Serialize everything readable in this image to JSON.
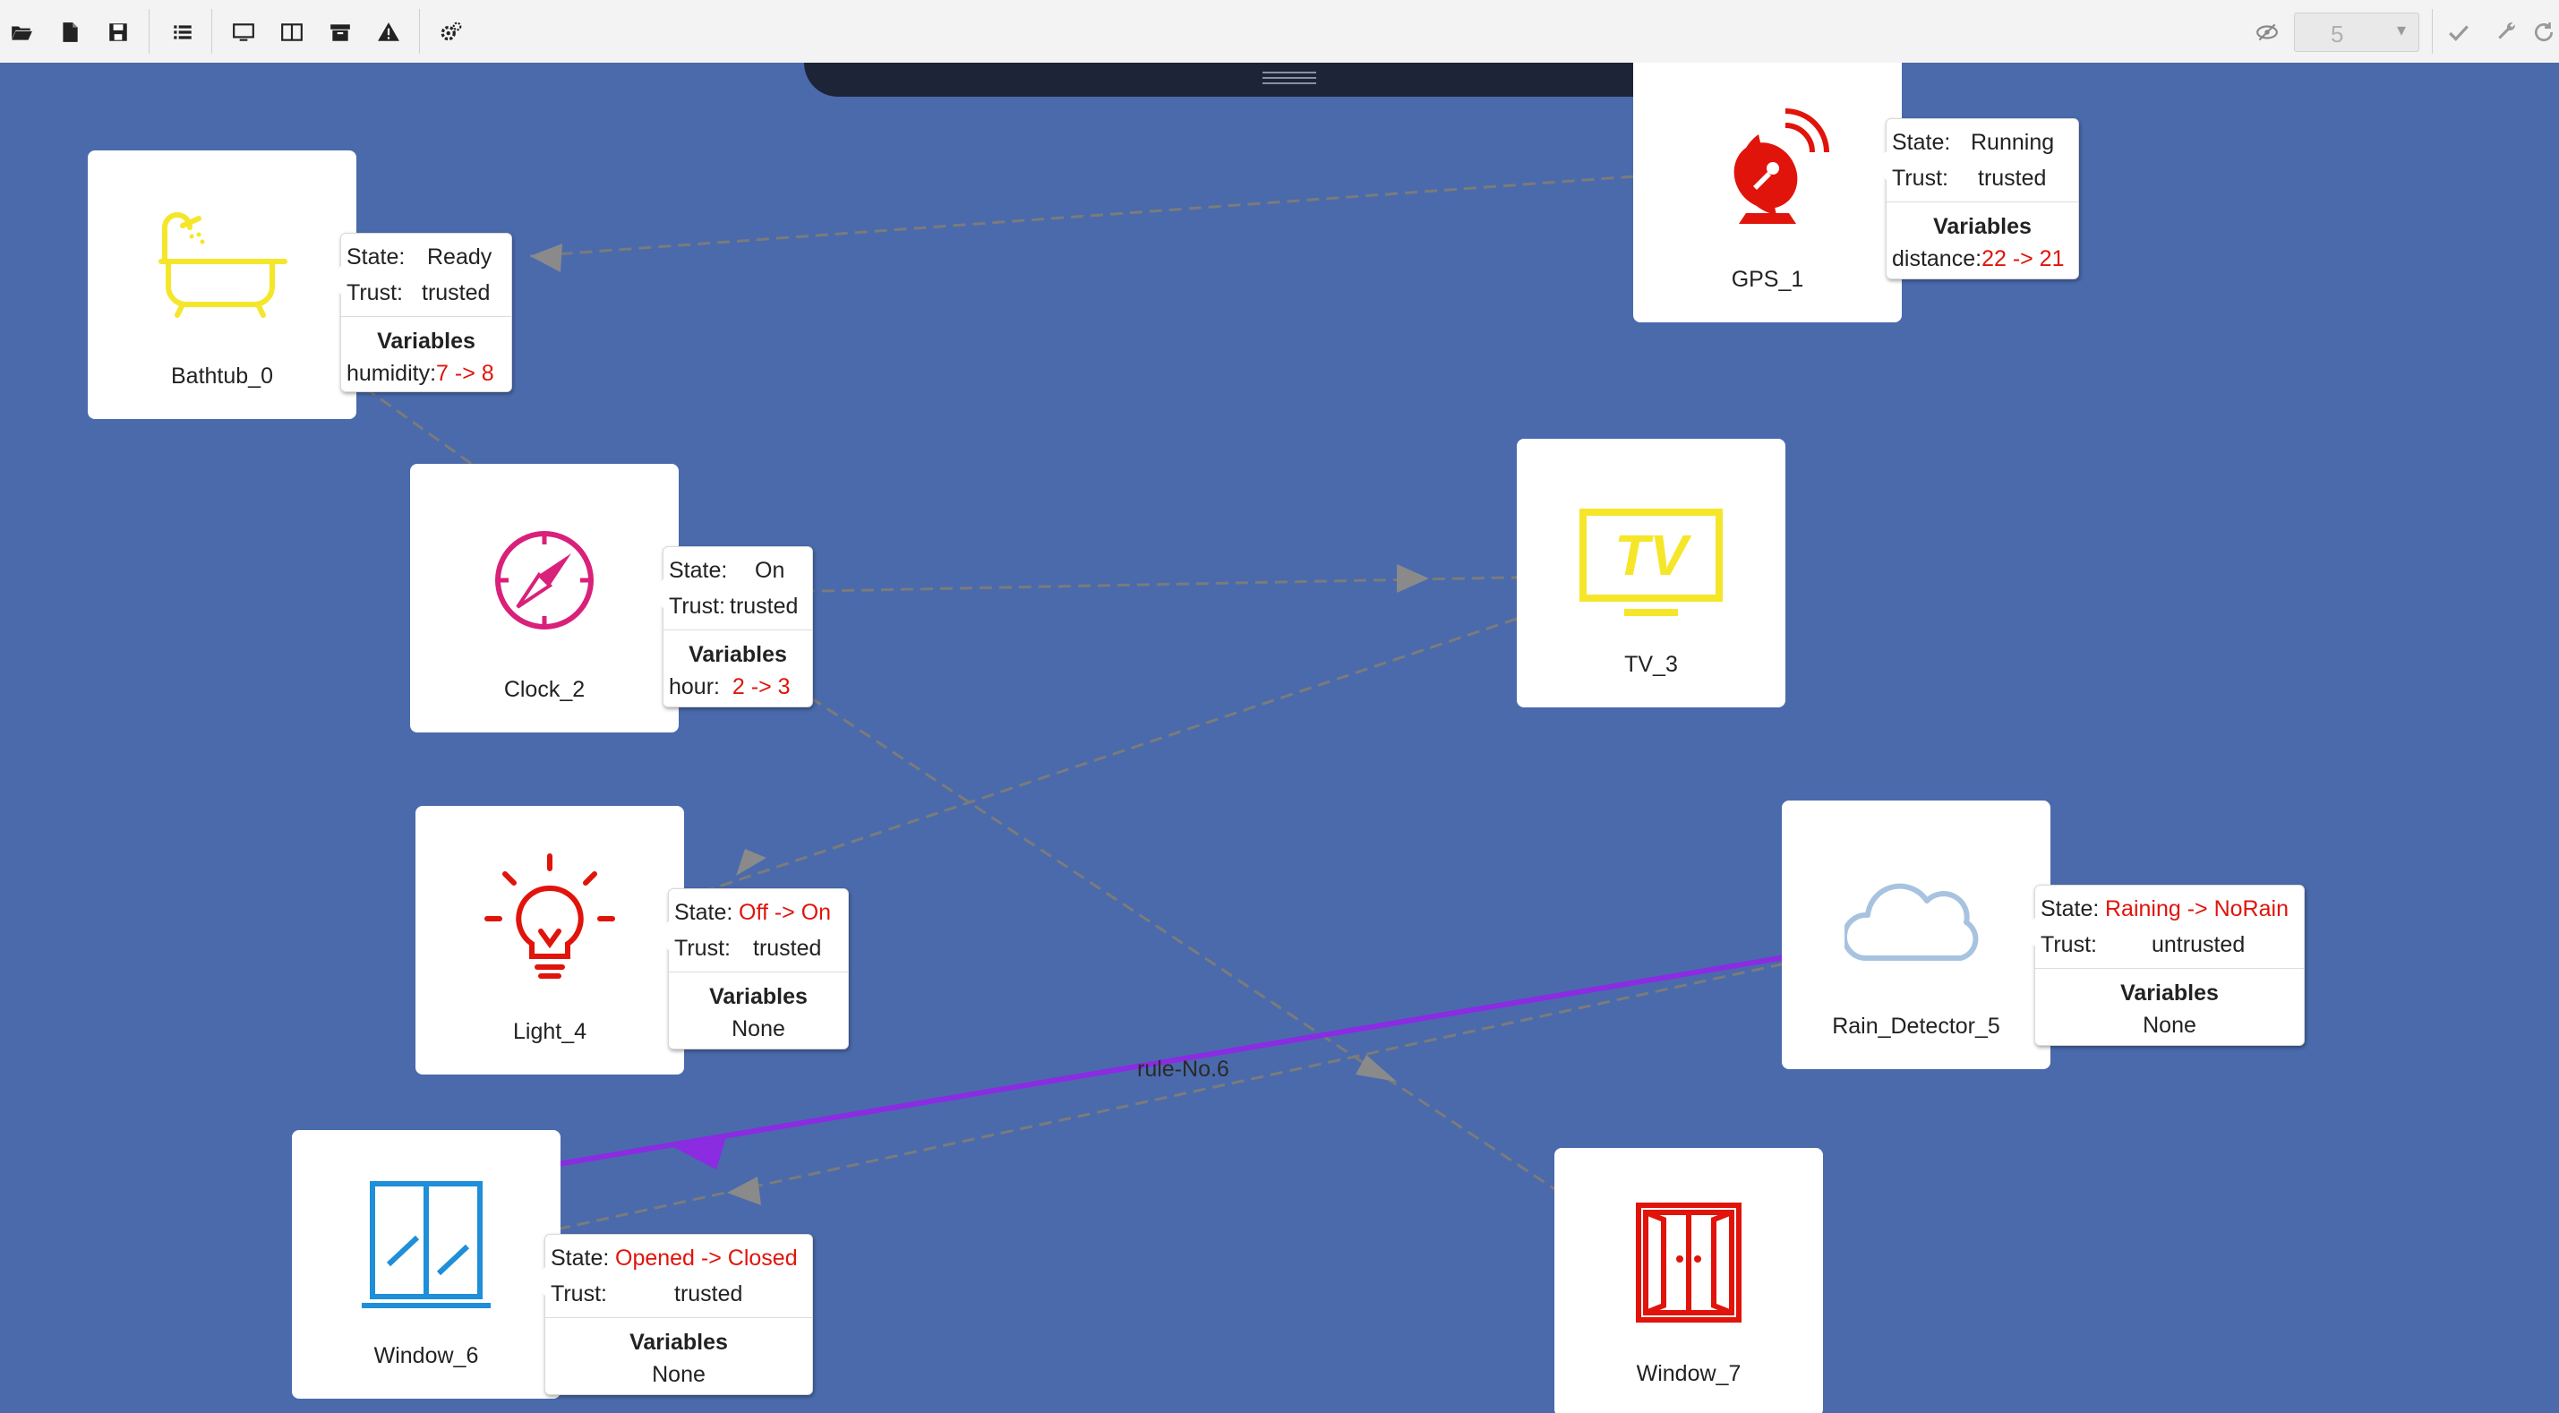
{
  "toolbar": {
    "left_icons": [
      "open-folder-icon",
      "new-file-icon",
      "save-icon",
      "list-icon",
      "monitor-icon",
      "columns-icon",
      "archive-icon",
      "warning-icon",
      "settings-icon"
    ],
    "right_icons": [
      "eye-off-icon",
      "check-icon",
      "wrench-icon",
      "refresh-icon"
    ],
    "step_value": "5"
  },
  "devices": [
    {
      "id": "bathtub",
      "name": "Bathtub_0",
      "icon": "bathtub-icon",
      "state": "Ready",
      "trust": "trusted",
      "variables_label": "Variables",
      "variable_name": "humidity:",
      "variable_value": "7 -> 8"
    },
    {
      "id": "gps",
      "name": "GPS_1",
      "icon": "satellite-dish-icon",
      "state": "Running",
      "trust": "trusted",
      "variables_label": "Variables",
      "variable_name": "distance:",
      "variable_value": "22 -> 21"
    },
    {
      "id": "clock",
      "name": "Clock_2",
      "icon": "compass-icon",
      "state": "On",
      "trust": "trusted",
      "variables_label": "Variables",
      "variable_name": "hour:",
      "variable_value": "2 -> 3"
    },
    {
      "id": "tv",
      "name": "TV_3",
      "icon": "tv-icon"
    },
    {
      "id": "light",
      "name": "Light_4",
      "icon": "lightbulb-icon",
      "state": "Off -> On",
      "trust": "trusted",
      "variables_label": "Variables",
      "variables_none": "None"
    },
    {
      "id": "rain",
      "name": "Rain_Detector_5",
      "icon": "cloud-icon",
      "state": "Raining -> NoRain",
      "trust": "untrusted",
      "variables_label": "Variables",
      "variables_none": "None"
    },
    {
      "id": "window6",
      "name": "Window_6",
      "icon": "window-icon",
      "state": "Opened -> Closed",
      "trust": "trusted",
      "variables_label": "Variables",
      "variables_none": "None"
    },
    {
      "id": "window7",
      "name": "Window_7",
      "icon": "door-icon"
    }
  ],
  "labels": {
    "state": "State:",
    "trust": "Trust:"
  },
  "rule_label": "rule-No.6",
  "colors": {
    "canvas": "#4a6aac",
    "edge": "#7b7b7b",
    "rule_edge": "#8b2be2",
    "changed_value": "#e0140b"
  }
}
